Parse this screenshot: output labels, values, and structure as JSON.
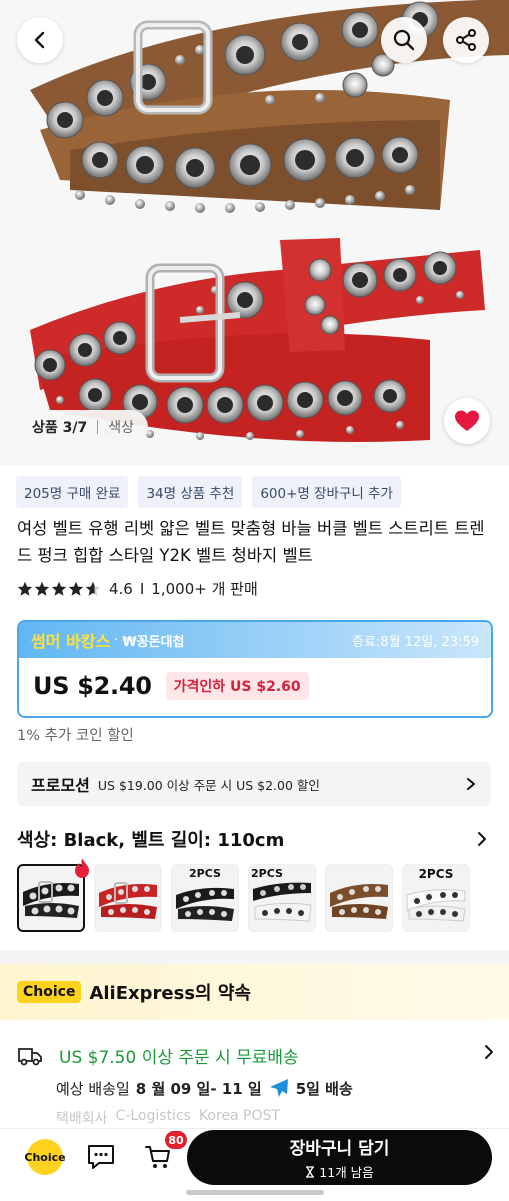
{
  "gallery": {
    "counter_label": "상품 3/7",
    "color_label": "색상"
  },
  "tags": [
    "205명 구매 완료",
    "34명 상품 추천",
    "600+명 장바구니 추가"
  ],
  "product": {
    "title": "여성 벨트 유행 리벳 얇은 벨트 맞춤형 바늘 버클 벨트 스트리트 트렌드 펑크 힙합 스타일 Y2K 벨트 청바지 벨트"
  },
  "rating": {
    "score": "4.6",
    "stars": 4.6,
    "divider": "I",
    "sold": "1,000+ 개 판매"
  },
  "price_card": {
    "promo_name": "썸머 바캉스",
    "promo_dot": "·",
    "promo_sub": "₩꽁돈대첩",
    "ends": "종료:8월 12일, 23:59",
    "price": "US $2.40",
    "discount": "가격인하 US $2.60"
  },
  "coin_discount": "1% 추가 코인 할인",
  "promotion": {
    "label": "프로모션",
    "text": "US $19.00 이상 주문 시 US $2.00 할인"
  },
  "variant": {
    "heading": "색상: Black, 벨트 길이: 110cm",
    "swatches": [
      {
        "badge": "",
        "color": "black",
        "selected": true
      },
      {
        "badge": "",
        "color": "red"
      },
      {
        "badge": "2PCS",
        "color": "black"
      },
      {
        "badge": "2PCS",
        "color": "black-white"
      },
      {
        "badge": "",
        "color": "brown"
      },
      {
        "badge": "2PCS",
        "color": "white"
      }
    ]
  },
  "choice": {
    "badge": "Choice",
    "title": "AliExpress의 약속"
  },
  "shipping": {
    "free": "US $7.50 이상 주문 시 무료배송",
    "eta_prefix": "예상 배송일",
    "eta_dates": "8 월 09 일- 11 일",
    "eta_days": "5일 배송",
    "carrier_line": [
      "택배회사",
      "C-Logistics",
      "Korea POST"
    ]
  },
  "bottom": {
    "choice_label": "Choice",
    "cart_count": "80",
    "cta_main": "장바구니 담기",
    "cta_sub": "11개 남음"
  },
  "colors": {
    "accent_blue": "#4aa7ea",
    "promo_yellow": "#ffe03b",
    "discount_red": "#d6213b",
    "free_green": "#1a9b3a",
    "heart_red": "#e5173f"
  }
}
